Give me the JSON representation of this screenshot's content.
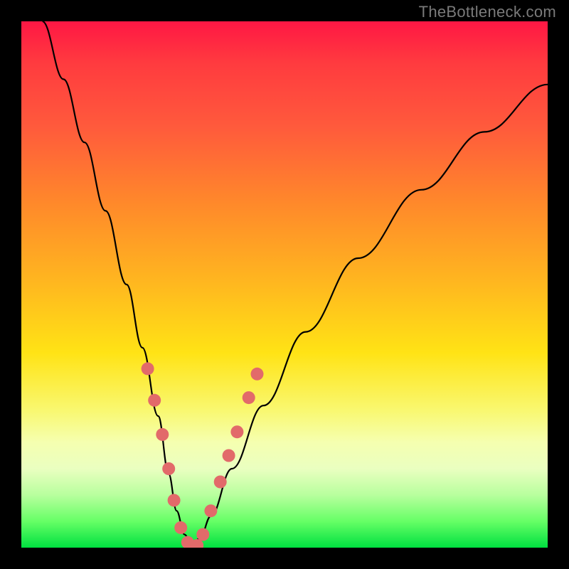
{
  "watermark": "TheBottleneck.com",
  "chart_data": {
    "type": "line",
    "title": "",
    "xlabel": "",
    "ylabel": "",
    "xlim": [
      0,
      100
    ],
    "ylim": [
      0,
      100
    ],
    "series": [
      {
        "name": "bottleneck-curve",
        "x": [
          4,
          8,
          12,
          16,
          20,
          23,
          26,
          28,
          29.5,
          31,
          32.5,
          34,
          36,
          40,
          46,
          54,
          64,
          76,
          88,
          100
        ],
        "values": [
          100,
          89,
          77,
          64,
          50,
          38,
          25,
          14,
          7,
          2.5,
          0,
          2,
          6,
          15,
          27,
          41,
          55,
          68,
          79,
          88
        ]
      }
    ],
    "markers": {
      "name": "highlight-dots",
      "color": "#e26a6a",
      "radius_px": 9,
      "points": [
        {
          "x": 24.0,
          "y": 34.0
        },
        {
          "x": 25.3,
          "y": 28.0
        },
        {
          "x": 26.8,
          "y": 21.5
        },
        {
          "x": 28.0,
          "y": 15.0
        },
        {
          "x": 29.0,
          "y": 9.0
        },
        {
          "x": 30.3,
          "y": 3.8
        },
        {
          "x": 31.6,
          "y": 1.0
        },
        {
          "x": 32.5,
          "y": 0.0
        },
        {
          "x": 33.4,
          "y": 0.4
        },
        {
          "x": 34.5,
          "y": 2.5
        },
        {
          "x": 36.0,
          "y": 7.0
        },
        {
          "x": 37.8,
          "y": 12.5
        },
        {
          "x": 39.4,
          "y": 17.5
        },
        {
          "x": 41.0,
          "y": 22.0
        },
        {
          "x": 43.2,
          "y": 28.5
        },
        {
          "x": 44.8,
          "y": 33.0
        }
      ]
    },
    "background_gradient": {
      "top": "#ff1744",
      "mid": "#ffe315",
      "bottom": "#00e040"
    }
  }
}
